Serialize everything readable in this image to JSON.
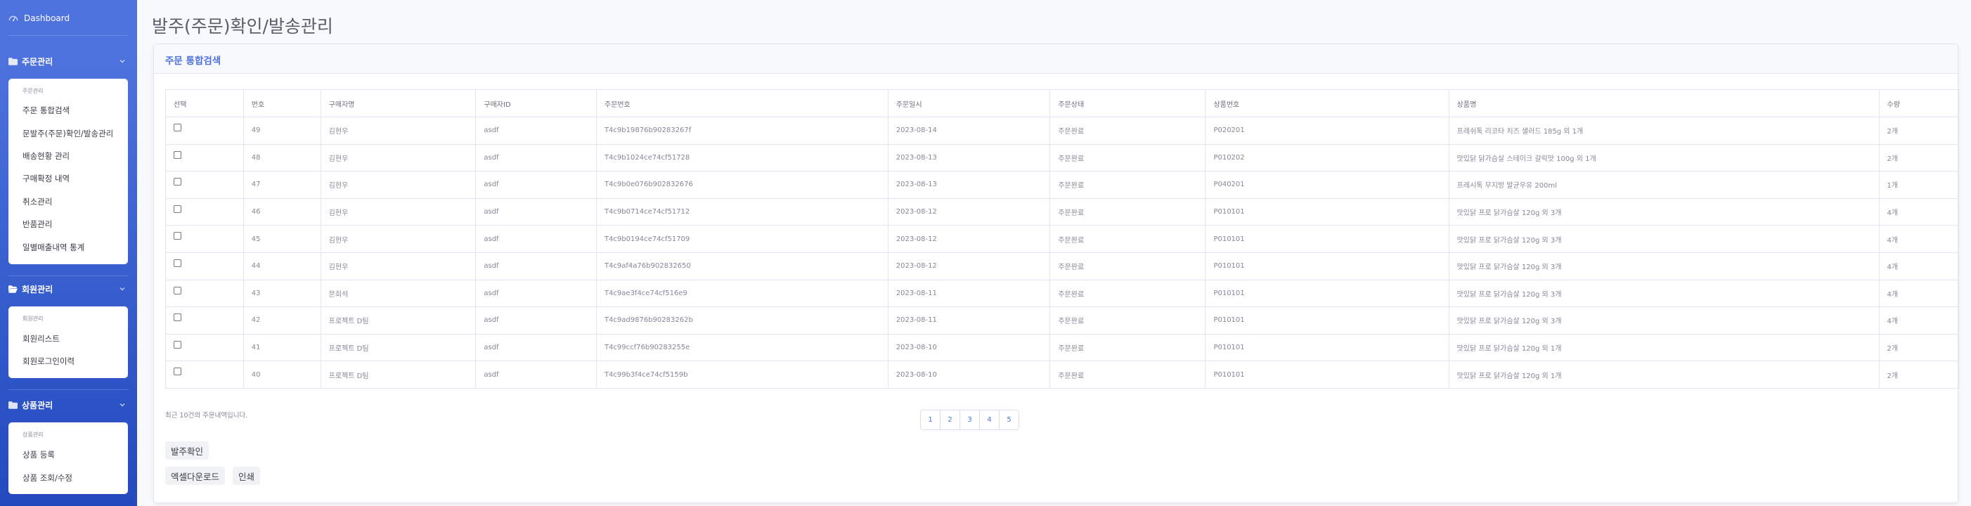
{
  "sidebar": {
    "dashboard": "Dashboard",
    "sections": [
      {
        "title": "주문관리",
        "header": "주문관리",
        "items": [
          "주문 통합검색",
          "문발주(주문)확인/발송관리",
          "배송현황 관리",
          "구매확정 내역",
          "취소관리",
          "반품관리",
          "일별매출내역 통계"
        ]
      },
      {
        "title": "회원관리",
        "header": "회원관리",
        "items": [
          "회원리스트",
          "회원로그인이력"
        ]
      },
      {
        "title": "상품관리",
        "header": "상품관리",
        "items": [
          "상품 등록",
          "상품 조회/수정"
        ]
      }
    ]
  },
  "page_title": "발주(주문)확인/발송관리",
  "panel": {
    "title": "주문 통합검색",
    "columns": [
      "선택",
      "번호",
      "구매자명",
      "구매자ID",
      "주문번호",
      "주문일시",
      "주문상태",
      "상품번호",
      "상품명",
      "수량"
    ],
    "rows": [
      [
        "49",
        "김현우",
        "asdf",
        "T4c9b19876b90283267f",
        "2023-08-14",
        "주문완료",
        "P020201",
        "프레쉬톡 리코타 치즈 샐러드 185g 외 1개",
        "2개"
      ],
      [
        "48",
        "김현우",
        "asdf",
        "T4c9b1024ce74cf51728",
        "2023-08-13",
        "주문완료",
        "P010202",
        "맛있닭 닭가슴살 스테이크 갈릭맛 100g 외 1개",
        "2개"
      ],
      [
        "47",
        "김현우",
        "asdf",
        "T4c9b0e076b902832676",
        "2023-08-13",
        "주문완료",
        "P040201",
        "프레시톡 무지방 발균우유 200ml",
        "1개"
      ],
      [
        "46",
        "김현우",
        "asdf",
        "T4c9b0714ce74cf51712",
        "2023-08-12",
        "주문완료",
        "P010101",
        "맛있닭 프로 닭가슴살 120g 외 3개",
        "4개"
      ],
      [
        "45",
        "김현우",
        "asdf",
        "T4c9b0194ce74cf51709",
        "2023-08-12",
        "주문완료",
        "P010101",
        "맛있닭 프로 닭가슴살 120g 외 3개",
        "4개"
      ],
      [
        "44",
        "김현우",
        "asdf",
        "T4c9af4a76b902832650",
        "2023-08-12",
        "주문완료",
        "P010101",
        "맛있닭 프로 닭가슴살 120g 외 3개",
        "4개"
      ],
      [
        "43",
        "문희석",
        "asdf",
        "T4c9ae3f4ce74cf516e9",
        "2023-08-11",
        "주문완료",
        "P010101",
        "맛있닭 프로 닭가슴살 120g 외 3개",
        "4개"
      ],
      [
        "42",
        "프로젝트 D팀",
        "asdf",
        "T4c9ad9876b90283262b",
        "2023-08-11",
        "주문완료",
        "P010101",
        "맛있닭 프로 닭가슴살 120g 외 3개",
        "4개"
      ],
      [
        "41",
        "프로젝트 D팀",
        "asdf",
        "T4c99ccf76b90283255e",
        "2023-08-10",
        "주문완료",
        "P010101",
        "맛있닭 프로 닭가슴살 120g 외 1개",
        "2개"
      ],
      [
        "40",
        "프로젝트 D팀",
        "asdf",
        "T4c99b3f4ce74cf5159b",
        "2023-08-10",
        "주문완료",
        "P010101",
        "맛있닭 프로 닭가슴살 120g 외 1개",
        "2개"
      ]
    ],
    "note": "최근 10건의 주문내역입니다.",
    "pages": [
      "1",
      "2",
      "3",
      "4",
      "5"
    ],
    "confirm_button": "발주확인",
    "excel_button": "엑셀다운로드",
    "print_button": "인쇄"
  },
  "colors": {
    "sidebar_primary": "#4e73df",
    "sidebar_dark": "#224abe",
    "accent": "#4e73df"
  }
}
